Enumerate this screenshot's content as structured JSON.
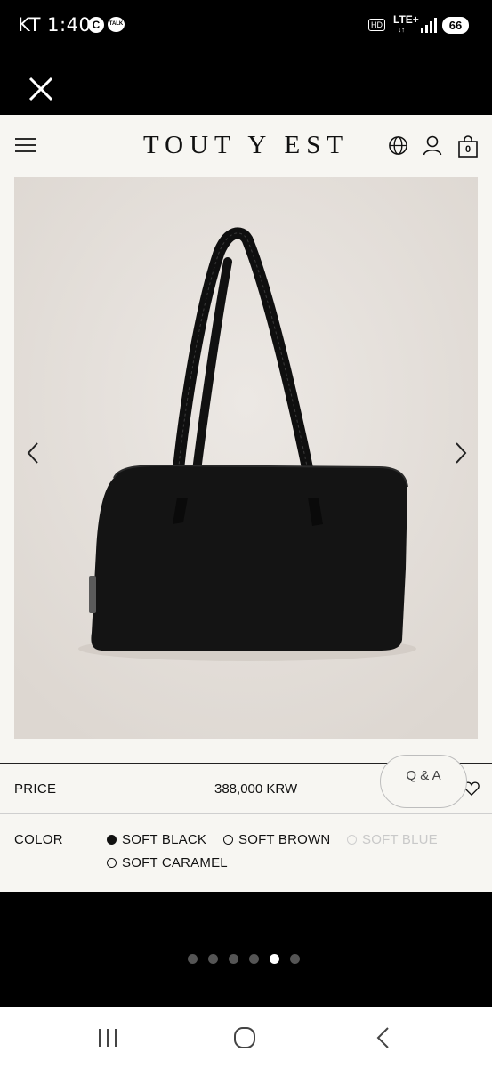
{
  "status_bar": {
    "carrier_time": "KT 1:40",
    "c_badge": "C",
    "talk_badge": "TALK",
    "hd": "HD",
    "network": "LTE+",
    "arrows": "↓↑",
    "battery": "66"
  },
  "header": {
    "logo": "TOUT Y EST",
    "cart_count": "0"
  },
  "price": {
    "label": "PRICE",
    "value": "388,000 KRW"
  },
  "color": {
    "label": "COLOR",
    "options": [
      {
        "name": "SOFT BLACK",
        "selected": true,
        "available": true
      },
      {
        "name": "SOFT BROWN",
        "selected": false,
        "available": true
      },
      {
        "name": "SOFT BLUE",
        "selected": false,
        "available": false
      },
      {
        "name": "SOFT CARAMEL",
        "selected": false,
        "available": true
      }
    ]
  },
  "qa_button": "Q & A",
  "gallery": {
    "page_count": 6,
    "active_index": 4
  },
  "colors": {
    "page_bg": "#f7f6f2",
    "image_bg": "#e6e1dc",
    "bag": "#141414"
  }
}
